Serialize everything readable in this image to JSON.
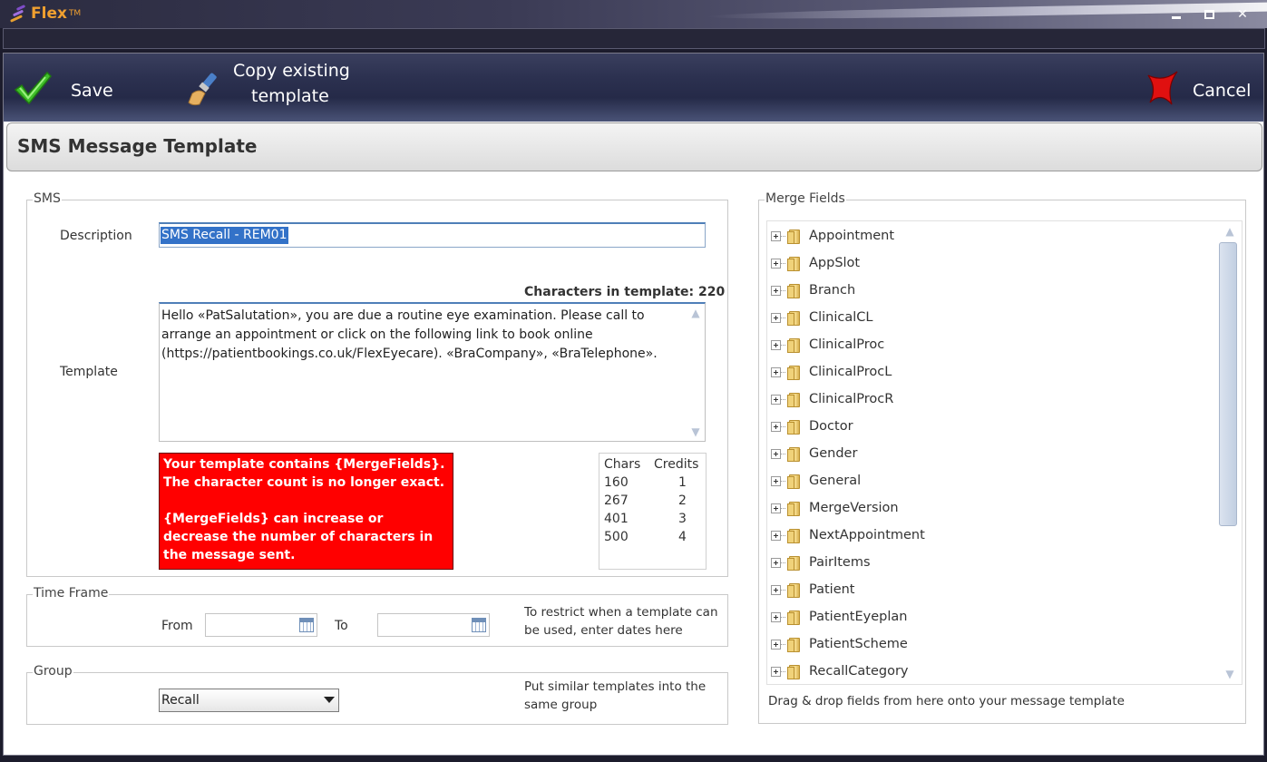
{
  "window": {
    "app_name": "Flex",
    "tm": "TM",
    "minimize": "▬",
    "maximize": "▣",
    "close": "✕"
  },
  "toolbar": {
    "save_label": "Save",
    "copy_label_line1": "Copy existing",
    "copy_label_line2": "template",
    "cancel_label": "Cancel"
  },
  "page_title": "SMS Message Template",
  "sms": {
    "legend": "SMS",
    "description_label": "Description",
    "description_value": "SMS Recall - REM01",
    "chars_label": "Characters in template:",
    "chars_count": "220",
    "template_label": "Template",
    "template_text": "Hello «PatSalutation», you are due a routine eye examination. Please call to arrange an appointment or click on the following link to book online (https://patientbookings.co.uk/FlexEyecare). «BraCompany», «BraTelephone».",
    "warning_line1": "Your template contains {MergeFields}. The character count is no longer exact.",
    "warning_line2": "{MergeFields} can increase or decrease the number of characters in the message sent.",
    "credits_table": {
      "headers": [
        "Chars",
        "Credits"
      ],
      "rows": [
        [
          "160",
          "1"
        ],
        [
          "267",
          "2"
        ],
        [
          "401",
          "3"
        ],
        [
          "500",
          "4"
        ]
      ]
    }
  },
  "time_frame": {
    "legend": "Time Frame",
    "from_label": "From",
    "to_label": "To",
    "from_value": "",
    "to_value": "",
    "note": "To restrict when a template can be used, enter dates here"
  },
  "group": {
    "legend": "Group",
    "selected": "Recall",
    "note": "Put similar templates into the same group"
  },
  "merge_fields": {
    "legend": "Merge Fields",
    "items": [
      "Appointment",
      "AppSlot",
      "Branch",
      "ClinicalCL",
      "ClinicalProc",
      "ClinicalProcL",
      "ClinicalProcR",
      "Doctor",
      "Gender",
      "General",
      "MergeVersion",
      "NextAppointment",
      "PairItems",
      "Patient",
      "PatientEyeplan",
      "PatientScheme",
      "RecallCategory"
    ],
    "hint": "Drag & drop fields from here onto your message template"
  },
  "colors": {
    "warning_bg": "#ff0000",
    "selection_bg": "#3372c8",
    "toolbar_bg": "#2c3150"
  },
  "icons": {
    "save": "check-icon",
    "copy": "brush-icon",
    "cancel": "x-icon"
  }
}
